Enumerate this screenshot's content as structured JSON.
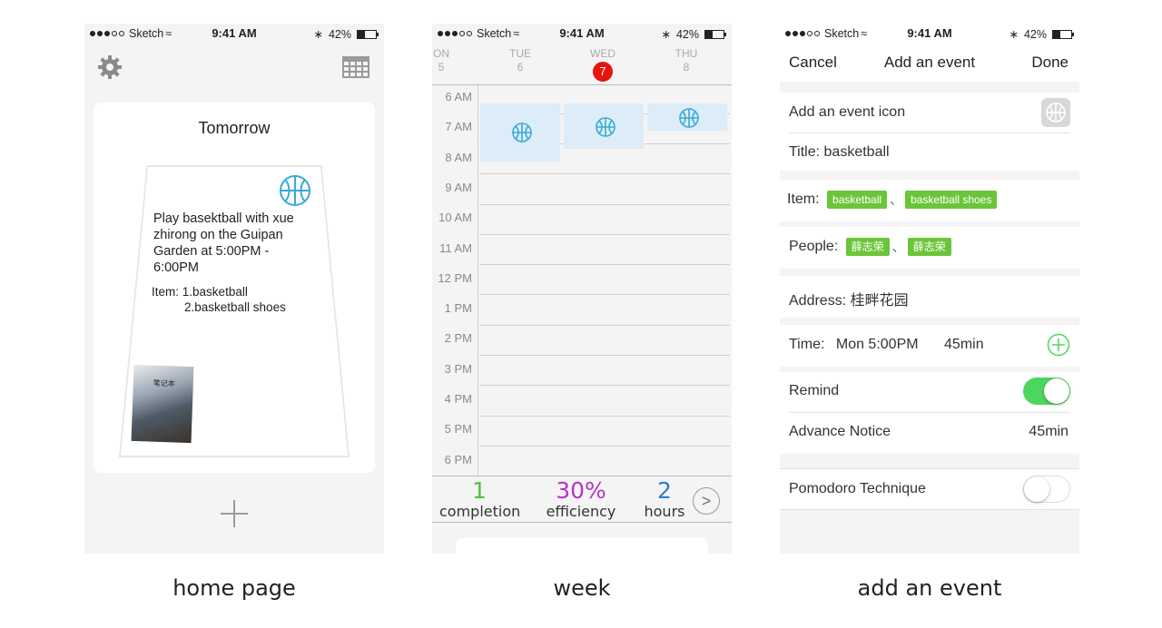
{
  "status": {
    "carrier": "Sketch",
    "time": "9:41 AM",
    "battery": "42%",
    "battery_level": 0.42
  },
  "home": {
    "caption": "home page",
    "heading": "Tomorrow",
    "event_text": "Play basektball with xue zhirong on the Guipan Garden  at 5:00PM - 6:00PM",
    "item_label": "Item:",
    "item_1": "1.basketball",
    "item_2": "2.basketball shoes",
    "photo_text": "笔记本"
  },
  "week": {
    "caption": "week",
    "days": [
      {
        "name": "ON",
        "num": "5"
      },
      {
        "name": "TUE",
        "num": "6"
      },
      {
        "name": "WED",
        "num": "7"
      },
      {
        "name": "THU",
        "num": "8"
      }
    ],
    "hours": [
      "6  AM",
      "7  AM",
      "8  AM",
      "9  AM",
      "10  AM",
      "11  AM",
      "12  PM",
      "1  PM",
      "2  PM",
      "3  PM",
      "4  PM",
      "5  PM",
      "6  PM"
    ],
    "stats": [
      {
        "value": "1",
        "label": "completion",
        "color": "#4cc33a"
      },
      {
        "value": "30%",
        "label": "efficiency",
        "color": "#b334c8"
      },
      {
        "value": "2",
        "label": "hours",
        "color": "#2f7ad8"
      }
    ],
    "next_glyph": ">",
    "event_color": "#dcedf7",
    "icon_color": "#3aa9d6"
  },
  "add": {
    "caption": "add an event",
    "cancel": "Cancel",
    "title": "Add an event",
    "done": "Done",
    "icon_label": "Add an event icon",
    "title_row": "Title: basketball",
    "item_label": "Item:",
    "items": [
      "basketball",
      "basketball shoes"
    ],
    "people_label": "People:",
    "people": [
      "薛志荣",
      "薛志荣"
    ],
    "separator": "、",
    "address": "Address: 桂畔花园",
    "time_label": "Time:",
    "time_value": "Mon 5:00PM",
    "time_duration": "45min",
    "remind_label": "Remind",
    "remind_on": true,
    "notice_label": "Advance Notice",
    "notice_value": "45min",
    "pomodoro_label": "Pomodoro Technique",
    "pomodoro_on": false,
    "accent": "#4cd55f",
    "tag_color": "#6bc53a"
  }
}
